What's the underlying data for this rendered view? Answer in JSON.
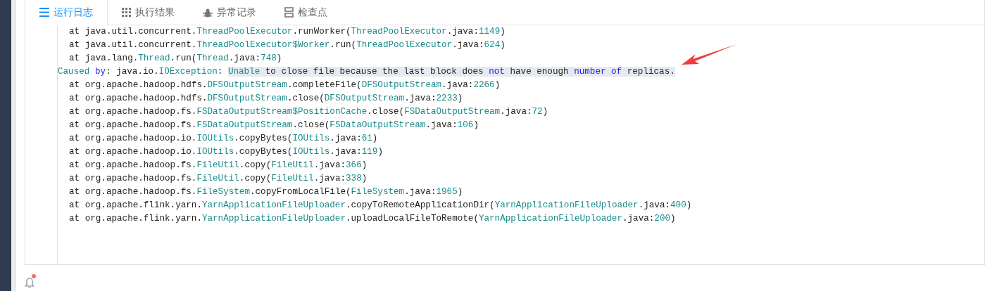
{
  "tabs": [
    {
      "label": "运行日志",
      "kind": "list",
      "selected": true
    },
    {
      "label": "执行结果",
      "kind": "grid",
      "selected": false
    },
    {
      "label": "异常记录",
      "kind": "bug",
      "selected": false
    },
    {
      "label": "检查点",
      "kind": "storage",
      "selected": false
    }
  ],
  "log_lines": [
    {
      "kind": "frame",
      "segments": [
        {
          "text": "at java.util.concurrent.",
          "kind": "plain"
        },
        {
          "text": "ThreadPoolExecutor",
          "kind": "type"
        },
        {
          "text": ".runWorker(",
          "kind": "plain"
        },
        {
          "text": "ThreadPoolExecutor",
          "kind": "type"
        },
        {
          "text": ".java:",
          "kind": "plain"
        },
        {
          "text": "1149",
          "kind": "num"
        },
        {
          "text": ")",
          "kind": "plain"
        }
      ]
    },
    {
      "kind": "frame",
      "segments": [
        {
          "text": "at java.util.concurrent.",
          "kind": "plain"
        },
        {
          "text": "ThreadPoolExecutor$Worker",
          "kind": "type"
        },
        {
          "text": ".run(",
          "kind": "plain"
        },
        {
          "text": "ThreadPoolExecutor",
          "kind": "type"
        },
        {
          "text": ".java:",
          "kind": "plain"
        },
        {
          "text": "624",
          "kind": "num"
        },
        {
          "text": ")",
          "kind": "plain"
        }
      ]
    },
    {
      "kind": "frame",
      "segments": [
        {
          "text": "at java.lang.",
          "kind": "plain"
        },
        {
          "text": "Thread",
          "kind": "type"
        },
        {
          "text": ".run(",
          "kind": "plain"
        },
        {
          "text": "Thread",
          "kind": "type"
        },
        {
          "text": ".java:",
          "kind": "plain"
        },
        {
          "text": "748",
          "kind": "num"
        },
        {
          "text": ")",
          "kind": "plain"
        }
      ]
    },
    {
      "kind": "cause",
      "segments": [
        {
          "text": "Caused ",
          "kind": "type"
        },
        {
          "text": "by",
          "kind": "kw"
        },
        {
          "text": ": java.io.",
          "kind": "plain"
        },
        {
          "text": "IOException",
          "kind": "type"
        },
        {
          "text": ": ",
          "kind": "plain"
        },
        {
          "text": "Unable",
          "kind": "type",
          "highlighted": true
        },
        {
          "text": " to close file because the last block does ",
          "kind": "plain",
          "highlighted": true
        },
        {
          "text": "not",
          "kind": "kw",
          "highlighted": true
        },
        {
          "text": " have enough ",
          "kind": "plain",
          "highlighted": true
        },
        {
          "text": "number of",
          "kind": "kw",
          "highlighted": true
        },
        {
          "text": " replicas.",
          "kind": "plain",
          "highlighted": true
        }
      ]
    },
    {
      "kind": "frame",
      "segments": [
        {
          "text": "at org.apache.hadoop.hdfs.",
          "kind": "plain"
        },
        {
          "text": "DFSOutputStream",
          "kind": "type"
        },
        {
          "text": ".completeFile(",
          "kind": "plain"
        },
        {
          "text": "DFSOutputStream",
          "kind": "type"
        },
        {
          "text": ".java:",
          "kind": "plain"
        },
        {
          "text": "2266",
          "kind": "num"
        },
        {
          "text": ")",
          "kind": "plain"
        }
      ]
    },
    {
      "kind": "frame",
      "segments": [
        {
          "text": "at org.apache.hadoop.hdfs.",
          "kind": "plain"
        },
        {
          "text": "DFSOutputStream",
          "kind": "type"
        },
        {
          "text": ".close(",
          "kind": "plain"
        },
        {
          "text": "DFSOutputStream",
          "kind": "type"
        },
        {
          "text": ".java:",
          "kind": "plain"
        },
        {
          "text": "2233",
          "kind": "num"
        },
        {
          "text": ")",
          "kind": "plain"
        }
      ]
    },
    {
      "kind": "frame",
      "segments": [
        {
          "text": "at org.apache.hadoop.fs.",
          "kind": "plain"
        },
        {
          "text": "FSDataOutputStream$PositionCache",
          "kind": "type"
        },
        {
          "text": ".close(",
          "kind": "plain"
        },
        {
          "text": "FSDataOutputStream",
          "kind": "type"
        },
        {
          "text": ".java:",
          "kind": "plain"
        },
        {
          "text": "72",
          "kind": "num"
        },
        {
          "text": ")",
          "kind": "plain"
        }
      ]
    },
    {
      "kind": "frame",
      "segments": [
        {
          "text": "at org.apache.hadoop.fs.",
          "kind": "plain"
        },
        {
          "text": "FSDataOutputStream",
          "kind": "type"
        },
        {
          "text": ".close(",
          "kind": "plain"
        },
        {
          "text": "FSDataOutputStream",
          "kind": "type"
        },
        {
          "text": ".java:",
          "kind": "plain"
        },
        {
          "text": "106",
          "kind": "num"
        },
        {
          "text": ")",
          "kind": "plain"
        }
      ]
    },
    {
      "kind": "frame",
      "segments": [
        {
          "text": "at org.apache.hadoop.io.",
          "kind": "plain"
        },
        {
          "text": "IOUtils",
          "kind": "type"
        },
        {
          "text": ".copyBytes(",
          "kind": "plain"
        },
        {
          "text": "IOUtils",
          "kind": "type"
        },
        {
          "text": ".java:",
          "kind": "plain"
        },
        {
          "text": "61",
          "kind": "num"
        },
        {
          "text": ")",
          "kind": "plain"
        }
      ]
    },
    {
      "kind": "frame",
      "segments": [
        {
          "text": "at org.apache.hadoop.io.",
          "kind": "plain"
        },
        {
          "text": "IOUtils",
          "kind": "type"
        },
        {
          "text": ".copyBytes(",
          "kind": "plain"
        },
        {
          "text": "IOUtils",
          "kind": "type"
        },
        {
          "text": ".java:",
          "kind": "plain"
        },
        {
          "text": "119",
          "kind": "num"
        },
        {
          "text": ")",
          "kind": "plain"
        }
      ]
    },
    {
      "kind": "frame",
      "segments": [
        {
          "text": "at org.apache.hadoop.fs.",
          "kind": "plain"
        },
        {
          "text": "FileUtil",
          "kind": "type"
        },
        {
          "text": ".copy(",
          "kind": "plain"
        },
        {
          "text": "FileUtil",
          "kind": "type"
        },
        {
          "text": ".java:",
          "kind": "plain"
        },
        {
          "text": "366",
          "kind": "num"
        },
        {
          "text": ")",
          "kind": "plain"
        }
      ]
    },
    {
      "kind": "frame",
      "segments": [
        {
          "text": "at org.apache.hadoop.fs.",
          "kind": "plain"
        },
        {
          "text": "FileUtil",
          "kind": "type"
        },
        {
          "text": ".copy(",
          "kind": "plain"
        },
        {
          "text": "FileUtil",
          "kind": "type"
        },
        {
          "text": ".java:",
          "kind": "plain"
        },
        {
          "text": "338",
          "kind": "num"
        },
        {
          "text": ")",
          "kind": "plain"
        }
      ]
    },
    {
      "kind": "frame",
      "segments": [
        {
          "text": "at org.apache.hadoop.fs.",
          "kind": "plain"
        },
        {
          "text": "FileSystem",
          "kind": "type"
        },
        {
          "text": ".copyFromLocalFile(",
          "kind": "plain"
        },
        {
          "text": "FileSystem",
          "kind": "type"
        },
        {
          "text": ".java:",
          "kind": "plain"
        },
        {
          "text": "1965",
          "kind": "num"
        },
        {
          "text": ")",
          "kind": "plain"
        }
      ]
    },
    {
      "kind": "frame",
      "segments": [
        {
          "text": "at org.apache.flink.yarn.",
          "kind": "plain"
        },
        {
          "text": "YarnApplicationFileUploader",
          "kind": "type"
        },
        {
          "text": ".copyToRemoteApplicationDir(",
          "kind": "plain"
        },
        {
          "text": "YarnApplicationFileUploader",
          "kind": "type"
        },
        {
          "text": ".java:",
          "kind": "plain"
        },
        {
          "text": "400",
          "kind": "num"
        },
        {
          "text": ")",
          "kind": "plain"
        }
      ]
    },
    {
      "kind": "frame",
      "segments": [
        {
          "text": "at org.apache.flink.yarn.",
          "kind": "plain"
        },
        {
          "text": "YarnApplicationFileUploader",
          "kind": "type"
        },
        {
          "text": ".uploadLocalFileToRemote(",
          "kind": "plain"
        },
        {
          "text": "YarnApplicationFileUploader",
          "kind": "type"
        },
        {
          "text": ".java:",
          "kind": "plain"
        },
        {
          "text": "200",
          "kind": "num"
        },
        {
          "text": ")",
          "kind": "plain"
        }
      ]
    }
  ],
  "notifications": {
    "unread": true
  }
}
